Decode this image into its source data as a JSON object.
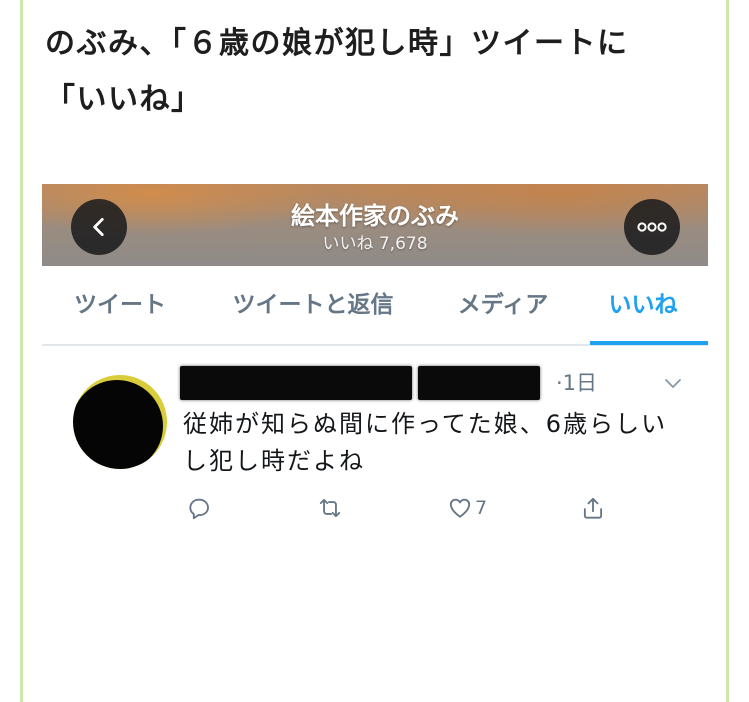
{
  "article": {
    "headline_line1": "のぶみ、「６歳の娘が犯し時」ツイートに",
    "headline_line2": "「いいね」"
  },
  "profile_header": {
    "title": "絵本作家のぶみ",
    "subtitle": "いいね 7,678",
    "back_icon": "chevron-left-icon",
    "more_icon": "more-dots-icon"
  },
  "tabs": [
    {
      "label": "ツイート",
      "active": false
    },
    {
      "label": "ツイートと返信",
      "active": false
    },
    {
      "label": "メディア",
      "active": false
    },
    {
      "label": "いいね",
      "active": true
    }
  ],
  "tweet": {
    "time": "·1日",
    "text_line1": "従姉が知らぬ間に作ってた娘、6歳らしい",
    "text_line2": "し犯し時だよね",
    "like_count": "7",
    "icons": [
      "reply-icon",
      "retweet-icon",
      "heart-icon",
      "share-icon",
      "chevron-down-icon"
    ]
  },
  "colors": {
    "accent_blue": "#1da1f2",
    "secondary_gray": "#657786",
    "frame_green": "#cde8aa",
    "tweet_text": "#14171a"
  }
}
